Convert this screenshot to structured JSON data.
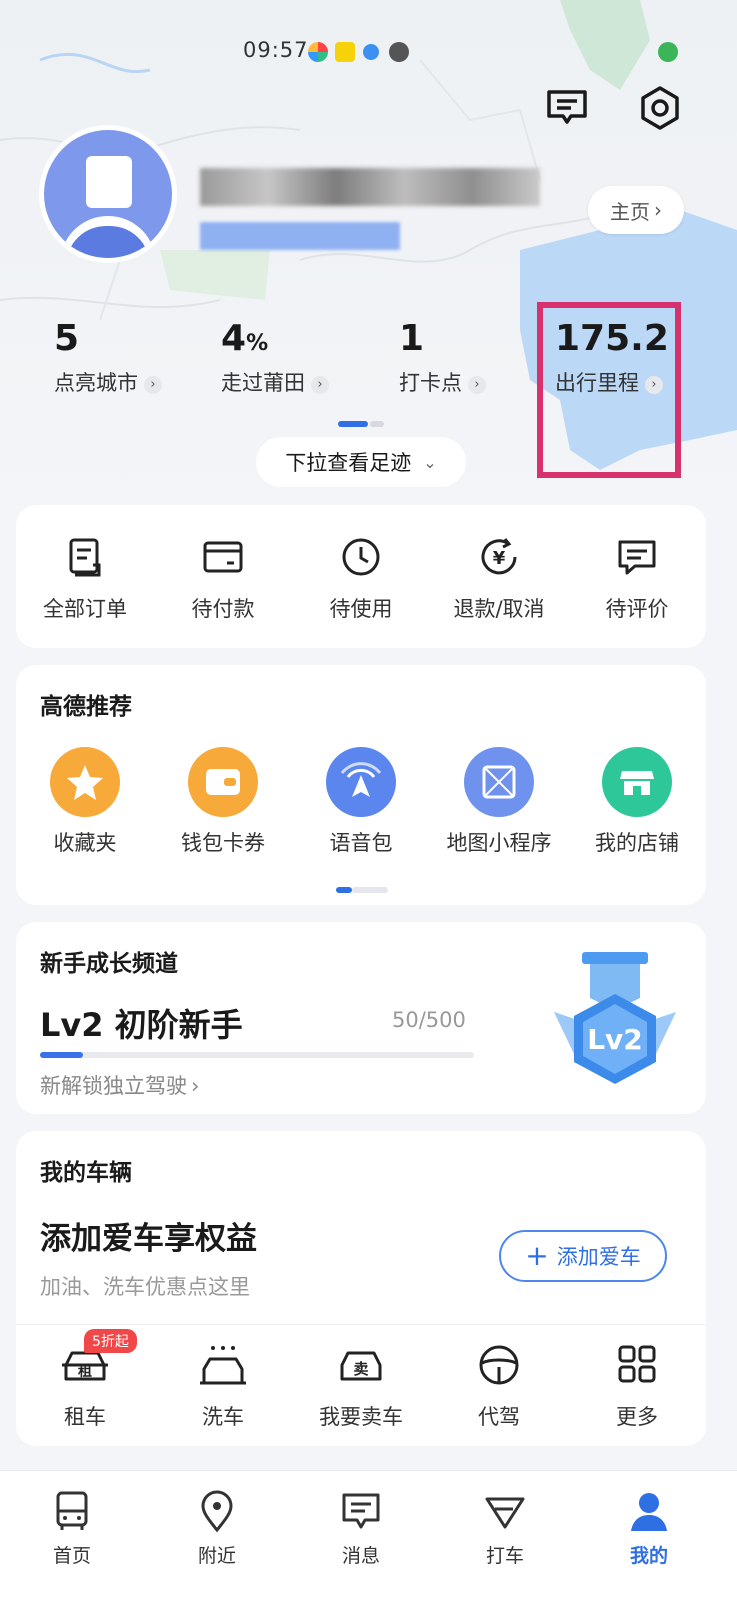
{
  "status_bar": {
    "time": "09:57"
  },
  "header": {
    "home_label": "主页"
  },
  "stats": [
    {
      "value": "5",
      "unit": "",
      "label": "点亮城市"
    },
    {
      "value": "4",
      "unit": "%",
      "label": "走过莆田"
    },
    {
      "value": "1",
      "unit": "",
      "label": "打卡点"
    },
    {
      "value": "175.2",
      "unit": "",
      "label": "出行里程"
    }
  ],
  "pull_down_label": "下拉查看足迹",
  "orders": [
    {
      "label": "全部订单",
      "icon": "order-list-icon"
    },
    {
      "label": "待付款",
      "icon": "wallet-card-icon"
    },
    {
      "label": "待使用",
      "icon": "clock-icon"
    },
    {
      "label": "退款/取消",
      "icon": "refund-yen-icon"
    },
    {
      "label": "待评价",
      "icon": "comment-icon"
    }
  ],
  "recommend": {
    "title": "高德推荐",
    "items": [
      {
        "label": "收藏夹",
        "icon": "star-icon",
        "color": "#f7a93a"
      },
      {
        "label": "钱包卡券",
        "icon": "wallet-icon",
        "color": "#f7a93a"
      },
      {
        "label": "语音包",
        "icon": "voice-nav-icon",
        "color": "#5a86ee"
      },
      {
        "label": "地图小程序",
        "icon": "mini-program-icon",
        "color": "#6f92ee"
      },
      {
        "label": "我的店铺",
        "icon": "shop-icon",
        "color": "#2ec79a"
      }
    ]
  },
  "growth": {
    "title": "新手成长频道",
    "level": "Lv2 初阶新手",
    "progress_text": "50/500",
    "progress": 0.1,
    "unlock": "新解锁独立驾驶",
    "badge_text": "Lv2"
  },
  "vehicle": {
    "title": "我的车辆",
    "headline": "添加爱车享权益",
    "subtitle": "加油、洗车优惠点这里",
    "add_button": "添加爱车",
    "services": [
      {
        "label": "租车",
        "icon": "rent-car-icon",
        "badge": "5折起",
        "glyph": "租"
      },
      {
        "label": "洗车",
        "icon": "car-wash-icon"
      },
      {
        "label": "我要卖车",
        "icon": "sell-car-icon",
        "glyph": "卖"
      },
      {
        "label": "代驾",
        "icon": "steering-wheel-icon"
      },
      {
        "label": "更多",
        "icon": "grid-more-icon"
      }
    ]
  },
  "tabs": [
    {
      "label": "首页",
      "icon": "bus-home-icon"
    },
    {
      "label": "附近",
      "icon": "location-pin-icon"
    },
    {
      "label": "消息",
      "icon": "message-icon"
    },
    {
      "label": "打车",
      "icon": "taxi-arrow-icon"
    },
    {
      "label": "我的",
      "icon": "profile-icon",
      "active": true
    }
  ],
  "colors": {
    "accent": "#2f6fe4",
    "highlight_box": "#d8326e"
  }
}
